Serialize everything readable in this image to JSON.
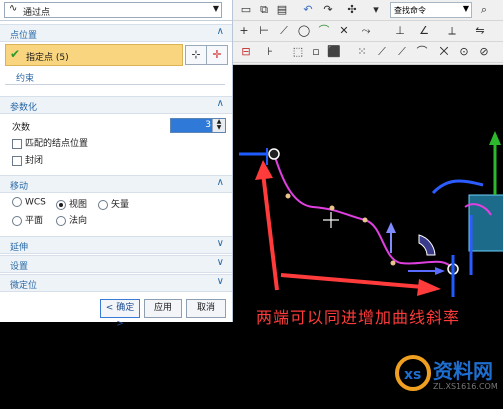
{
  "dialog": {
    "type_select": "通过点",
    "sections": {
      "point_location": "点位置",
      "parameterization": "参数化",
      "move": "移动",
      "extend": "延伸",
      "settings": "设置",
      "micro_position": "微定位"
    },
    "specified_points": "指定点 (5)",
    "constraint_link": "约束",
    "degree_label": "次数",
    "degree_value": "3",
    "match_knot": "匹配的结点位置",
    "closed": "封闭",
    "move_options": {
      "wcs": "WCS",
      "view": "视图",
      "vector": "矢量",
      "plane": "平面",
      "normal": "法向"
    },
    "buttons": {
      "ok": "< 确定 >",
      "apply": "应用",
      "cancel": "取消"
    }
  },
  "toolbar": {
    "search_placeholder": "查找命令"
  },
  "canvas": {
    "annotation": "两端可以同进增加曲线斜率"
  },
  "watermark": {
    "brand": "资料网",
    "url": "ZL.XS1616.COM"
  },
  "colors": {
    "accent": "#2a69a6",
    "highlight_row": "#f8d57e",
    "curve": "#e040e0",
    "annotation": "#ff3b3b"
  }
}
